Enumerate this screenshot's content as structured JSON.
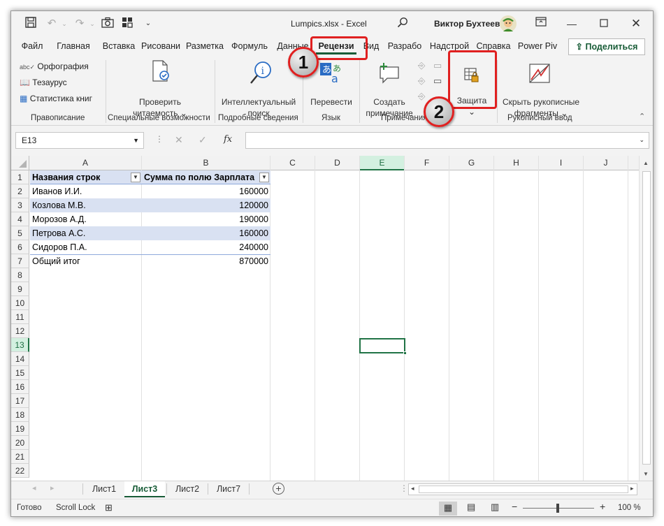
{
  "titlebar": {
    "filename": "Lumpics.xlsx",
    "app_sep": " - ",
    "app": "Excel",
    "user": "Виктор Бухтеев"
  },
  "tabs": [
    "Файл",
    "Главная",
    "Вставка",
    "Рисовани",
    "Разметка",
    "Формуль",
    "Данные",
    "Рецензи",
    "Вид",
    "Разрабо",
    "Надстрой",
    "Справка",
    "Power Piv"
  ],
  "active_tab": "Рецензи",
  "share_label": "Поделиться",
  "ribbon": {
    "spelling": {
      "items": [
        "Орфография",
        "Тезаурус",
        "Статистика книг"
      ],
      "group": "Правописание"
    },
    "accessibility": {
      "label_line1": "Проверить",
      "label_line2": "читаемость",
      "group": "Специальные возможности"
    },
    "insights": {
      "label_line1": "Интеллектуальный",
      "label_line2": "поиск",
      "group": "Подробные сведения"
    },
    "language": {
      "label": "Перевести",
      "group": "Язык"
    },
    "comments": {
      "label_line1": "Создать",
      "label_line2": "примечание",
      "group": "Примечания"
    },
    "protect": {
      "label": "Защита"
    },
    "ink": {
      "label_line1": "Скрыть рукописные",
      "label_line2": "фрагменты",
      "group": "Рукописный ввод"
    }
  },
  "annotations": {
    "badge1": "1",
    "badge2": "2"
  },
  "formula_bar": {
    "name_box": "E13",
    "fx": "fx",
    "formula": ""
  },
  "columns": [
    "A",
    "B",
    "C",
    "D",
    "E",
    "F",
    "G",
    "H",
    "I",
    "J"
  ],
  "selected_column": "E",
  "rows": [
    "1",
    "2",
    "3",
    "4",
    "5",
    "6",
    "7",
    "8",
    "9",
    "10",
    "11",
    "12",
    "13",
    "14",
    "15",
    "16",
    "17",
    "18",
    "19",
    "20",
    "21",
    "22"
  ],
  "selected_row": "13",
  "pivot": {
    "header_a": "Названия строк",
    "header_b": "Сумма по полю Зарплата",
    "data": [
      {
        "name": "Иванов И.И.",
        "value": "160000"
      },
      {
        "name": "Козлова М.В.",
        "value": "120000"
      },
      {
        "name": "Морозов А.Д.",
        "value": "190000"
      },
      {
        "name": "Петрова А.С.",
        "value": "160000"
      },
      {
        "name": "Сидоров П.А.",
        "value": "240000"
      },
      {
        "name": "Общий итог",
        "value": "870000"
      }
    ]
  },
  "sheets": [
    "Лист1",
    "Лист3",
    "Лист2",
    "Лист7"
  ],
  "active_sheet": "Лист3",
  "status": {
    "ready": "Готово",
    "scroll_lock": "Scroll Lock",
    "zoom": "100 %"
  },
  "colors": {
    "excel_green": "#217346",
    "selection_fill": "#d3f0e0",
    "pivot_band": "#d9e1f2",
    "annotation_red": "#e02020"
  }
}
